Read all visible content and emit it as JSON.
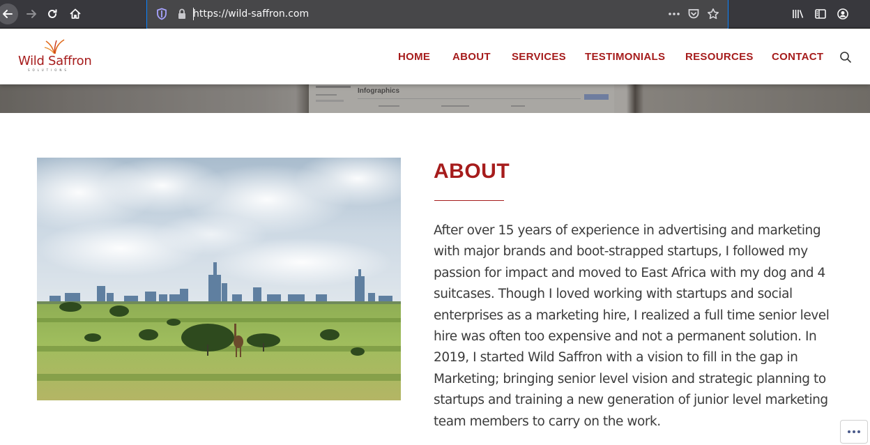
{
  "browser": {
    "url": "https://wild-saffron.com",
    "chrome_colors": {
      "toolbar": "#38383d",
      "focus_ring": "#0a84ff"
    }
  },
  "site": {
    "logo": {
      "name": "Wild Saffron",
      "tagline": "SOLUTIONS"
    },
    "nav": [
      "HOME",
      "ABOUT",
      "SERVICES",
      "TESTIMONIALS",
      "RESOURCES",
      "CONTACT"
    ],
    "hero_caption": "Infographics",
    "accent_color": "#a61c1c"
  },
  "about": {
    "title": "ABOUT",
    "body": "After over 15 years of experience in advertising and marketing with major brands and boot-strapped startups, I followed my passion for impact and moved to East Africa with my dog and 4 suitcases. Though I loved working with startups and social enterprises as a marketing hire, I realized a full time senior level hire was often too expensive and not a permanent solution. In 2019, I started Wild Saffron with a vision to fill in the gap in Marketing; bringing senior level vision and strategic planning to startups and training a new generation of junior level marketing team members to carry on the work."
  }
}
